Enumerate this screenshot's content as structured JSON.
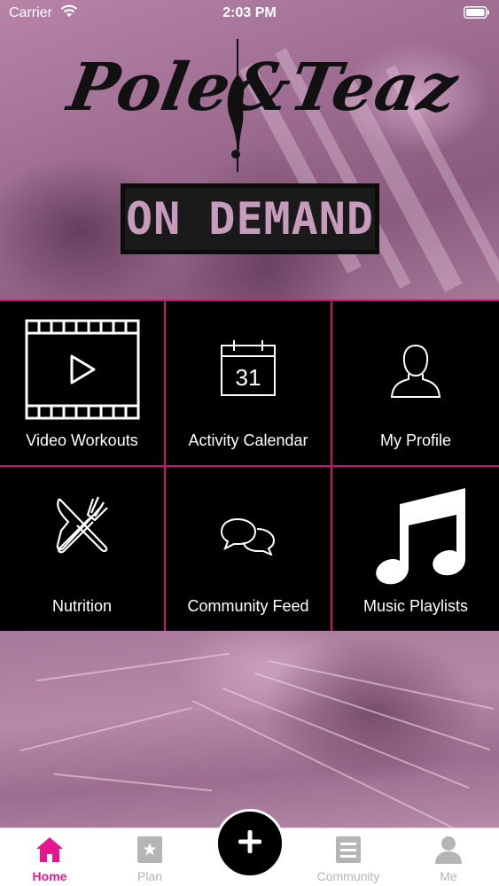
{
  "status_bar": {
    "carrier": "Carrier",
    "time": "2:03 PM"
  },
  "hero": {
    "logo_text": "Pole&Teaz",
    "badge_text": "ON DEMAND"
  },
  "tiles": [
    {
      "label": "Video Workouts",
      "icon": "video-icon"
    },
    {
      "label": "Activity Calendar",
      "icon": "calendar-icon",
      "calendar_day": "31"
    },
    {
      "label": "My Profile",
      "icon": "profile-icon"
    },
    {
      "label": "Nutrition",
      "icon": "fork-knife-icon"
    },
    {
      "label": "Community Feed",
      "icon": "chat-bubbles-icon"
    },
    {
      "label": "Music Playlists",
      "icon": "music-note-icon"
    }
  ],
  "tab_bar": {
    "tabs": [
      {
        "label": "Home",
        "icon": "home-icon",
        "active": true
      },
      {
        "label": "Plan",
        "icon": "star-icon",
        "active": false
      },
      {
        "label": "Community",
        "icon": "book-icon",
        "active": false
      },
      {
        "label": "Me",
        "icon": "person-icon",
        "active": false
      }
    ],
    "add_icon": "plus-icon"
  },
  "colors": {
    "accent": "#e6168f",
    "grid_border": "#d1136f",
    "tile_bg": "#000000",
    "hero_tint": "#a57596"
  }
}
